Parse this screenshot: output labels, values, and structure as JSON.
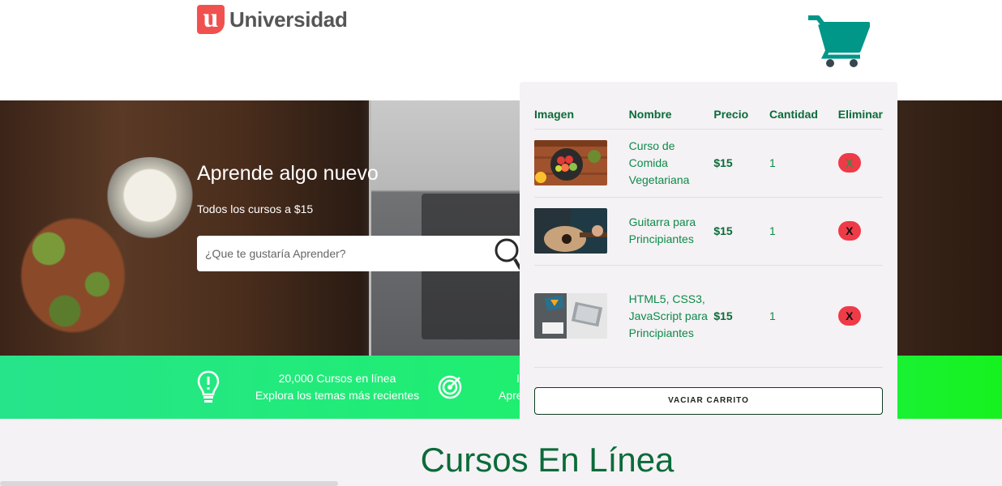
{
  "header": {
    "logo_mark": "u",
    "logo_text": "Universidad",
    "cart_icon": "shopping-cart-icon"
  },
  "hero": {
    "title": "Aprende algo nuevo",
    "subtitle": "Todos los cursos a $15",
    "search_placeholder": "¿Que te gustaría Aprender?"
  },
  "features": [
    {
      "icon": "lightbulb-icon",
      "line1": "20,000 Cursos en línea",
      "line2": "Explora los temas más recientes"
    },
    {
      "icon": "target-icon",
      "line1": "I",
      "line2": "Apre"
    }
  ],
  "cart": {
    "headers": [
      "Imagen",
      "Nombre",
      "Precio",
      "Cantidad",
      "Eliminar"
    ],
    "items": [
      {
        "name": "Curso de Comida Vegetariana",
        "price": "$15",
        "qty": "1",
        "delete": "X"
      },
      {
        "name": "Guitarra para Principiantes",
        "price": "$15",
        "qty": "1",
        "delete": "X"
      },
      {
        "name": "HTML5, CSS3, JavaScript para Principiantes",
        "price": "$15",
        "qty": "1",
        "delete": "X"
      }
    ],
    "empty_button": "VACIAR CARRITO"
  },
  "main": {
    "section_title": "Cursos En Línea"
  },
  "colors": {
    "brand_green": "#0b6b3a",
    "cart_teal": "#009688",
    "band_green": "#1ef06c",
    "delete_red": "#ef3a47",
    "logo_red": "#f0514f"
  }
}
